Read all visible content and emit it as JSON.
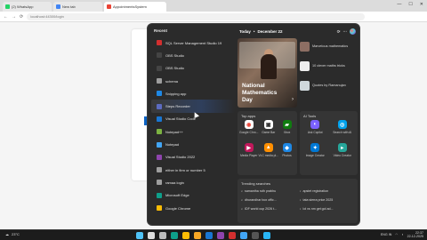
{
  "browser": {
    "tabs": [
      {
        "label": "(2) WhatsApp",
        "color": "#25d366"
      },
      {
        "label": "New tab",
        "color": "#4285f4"
      },
      {
        "label": "AppointmentsSystem",
        "color": "#ea4335"
      }
    ],
    "window_controls": [
      "—",
      "☐",
      "✕"
    ],
    "address": "localhost:44300/login"
  },
  "start_menu": {
    "recent_title": "Recent",
    "recent_apps": [
      {
        "label": "SQL Server Management Studio 19",
        "color": "#d32f2f"
      },
      {
        "label": "OBS Studio",
        "color": "#444444"
      },
      {
        "label": "OBS Studio",
        "color": "#444444"
      },
      {
        "label": "schema",
        "color": "#9e9e9e"
      },
      {
        "label": "Snipping app",
        "color": "#1e88e5"
      },
      {
        "label": "Steps Recorder",
        "color": "#5c6bc0"
      },
      {
        "label": "Visual Studio Code",
        "color": "#1976d2"
      },
      {
        "label": "Notepad++",
        "color": "#7cb342"
      },
      {
        "label": "Notepad",
        "color": "#42a5f5"
      },
      {
        "label": "Visual Studio 2022",
        "color": "#8e44ad"
      },
      {
        "label": "either in firm or number 5",
        "color": "#9e9e9e"
      },
      {
        "label": "ramaa login",
        "color": "#9e9e9e"
      },
      {
        "label": "Microsoft Edge",
        "color": "#0e9f8a"
      },
      {
        "label": "Google Chrome",
        "color": "#fbbc05"
      }
    ],
    "highlighted_index": 5,
    "today": {
      "label": "Today",
      "separator": "•",
      "date": "December 22"
    },
    "hero": {
      "title": "National Mathematics Day",
      "next_glyph": "›"
    },
    "news": [
      {
        "text": "Marvelous mathematics",
        "color": "#8d6e63"
      },
      {
        "text": "10 clever maths tricks",
        "color": "#eeeeee"
      },
      {
        "text": "Quotes by Ramanujan",
        "color": "#cfd8dc"
      }
    ],
    "top_apps": {
      "title": "Top apps",
      "tiles": [
        {
          "label": "Google Chro...",
          "glyph": "◉",
          "bg": "#ffffff",
          "fg": "#ea4335"
        },
        {
          "label": "Game Bar",
          "glyph": "▣",
          "bg": "#ffffff",
          "fg": "#333333"
        },
        {
          "label": "Xbox",
          "glyph": "▰",
          "bg": "#107c10",
          "fg": "#ffffff"
        },
        {
          "label": "Media Player",
          "glyph": "▶",
          "bg": "#c2185b",
          "fg": "#ffffff"
        },
        {
          "label": "VLC media pl...",
          "glyph": "▲",
          "bg": "#ff8f00",
          "fg": "#ffffff"
        },
        {
          "label": "Photos",
          "glyph": "◆",
          "bg": "#1e88e5",
          "fg": "#ffffff"
        }
      ]
    },
    "ai_tools": {
      "title": "AI Tools",
      "tiles": [
        {
          "label": "Ask Copilot",
          "glyph": "◐",
          "bg": "#7b61ff",
          "fg": "#ffffff"
        },
        {
          "label": "Search with AI",
          "glyph": "◎",
          "bg": "#00a2ed",
          "fg": "#ffffff"
        },
        {
          "label": "Image Creator",
          "glyph": "✦",
          "bg": "#0078d4",
          "fg": "#ffffff"
        },
        {
          "label": "Video Creator",
          "glyph": "▸",
          "bg": "#26a69a",
          "fg": "#ffffff"
        }
      ]
    },
    "trending": {
      "title": "Trending searches",
      "items": [
        "samantha ruth prabhu",
        "apstet registration",
        "dhurandhar box offic...",
        "tata sierra price 2025",
        "IDF world cup 2026 t...",
        "lol vs nm get gol ad..."
      ]
    },
    "top_right_icons": [
      "⟳",
      "⋯"
    ]
  },
  "taskbar": {
    "weather": "23°C",
    "icons": [
      {
        "name": "start-icon",
        "color": "#4fc3f7"
      },
      {
        "name": "search-icon",
        "color": "#dddddd"
      },
      {
        "name": "task-view-icon",
        "color": "#bbbbbb"
      },
      {
        "name": "edge-icon",
        "color": "#0e9f8a"
      },
      {
        "name": "chrome-icon",
        "color": "#fbbc05"
      },
      {
        "name": "explorer-icon",
        "color": "#f9a825"
      },
      {
        "name": "vscode-icon",
        "color": "#1976d2"
      },
      {
        "name": "vs-icon",
        "color": "#8e44ad"
      },
      {
        "name": "sql-icon",
        "color": "#d32f2f"
      },
      {
        "name": "notepad-icon",
        "color": "#42a5f5"
      },
      {
        "name": "obs-icon",
        "color": "#555555"
      },
      {
        "name": "store-icon",
        "color": "#29b6f6"
      }
    ],
    "tray": {
      "lang": "ENG IN",
      "time": "22:37",
      "date": "22-12-2025"
    }
  }
}
